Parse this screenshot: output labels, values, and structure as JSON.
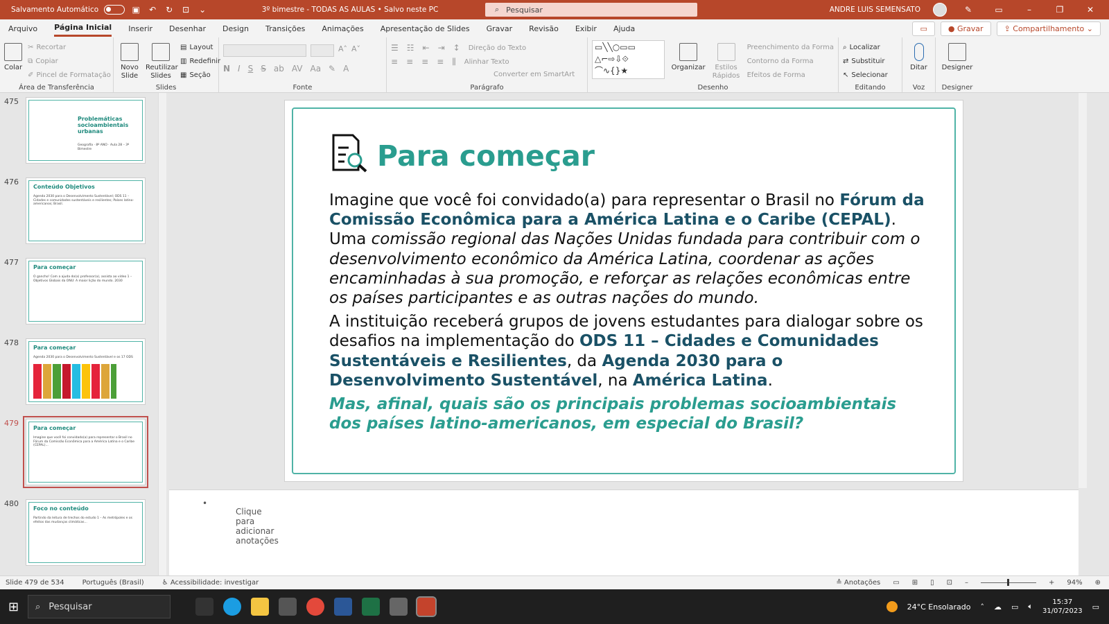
{
  "titlebar": {
    "autosave_label": "Salvamento Automático",
    "document_title": "3º bimestre - TODAS AS AULAS • Salvo neste PC",
    "search_placeholder": "Pesquisar",
    "user_name": "ANDRE LUIS SEMENSATO"
  },
  "menu": {
    "items": [
      "Arquivo",
      "Página Inicial",
      "Inserir",
      "Desenhar",
      "Design",
      "Transições",
      "Animações",
      "Apresentação de Slides",
      "Gravar",
      "Revisão",
      "Exibir",
      "Ajuda"
    ],
    "active": "Página Inicial",
    "record_button": "Gravar",
    "share_button": "Compartilhamento"
  },
  "ribbon": {
    "clipboard": {
      "label": "Área de Transferência",
      "paste": "Colar",
      "cut": "Recortar",
      "copy": "Copiar",
      "format_painter": "Pincel de Formatação"
    },
    "slides": {
      "label": "Slides",
      "new_slide": "Novo Slide",
      "reuse": "Reutilizar Slides",
      "layout": "Layout",
      "reset": "Redefinir",
      "section": "Seção"
    },
    "font": {
      "label": "Fonte"
    },
    "paragraph": {
      "label": "Parágrafo",
      "text_direction": "Direção do Texto",
      "align_text": "Alinhar Texto",
      "smartart": "Converter em SmartArt"
    },
    "drawing": {
      "label": "Desenho",
      "arrange": "Organizar",
      "quick_styles": "Estilos Rápidos",
      "shape_fill": "Preenchimento da Forma",
      "shape_outline": "Contorno da Forma",
      "shape_effects": "Efeitos de Forma"
    },
    "editing": {
      "label": "Editando",
      "find": "Localizar",
      "replace": "Substituir",
      "select": "Selecionar"
    },
    "voice": {
      "label": "Voz",
      "dictate": "Ditar"
    },
    "designer": {
      "label": "Designer",
      "designer": "Designer"
    }
  },
  "thumbnails": [
    {
      "num": "475",
      "title": "Problemáticas socioambientais urbanas",
      "text": "Geografia · 8º ANO · Aula 28 – 3º Bimestre"
    },
    {
      "num": "476",
      "title": "Conteúdo   Objetivos",
      "text": "Agenda 2030 para o Desenvolvimento Sustentável; ODS 11 – Cidades e comunidades sustentáveis e resilientes; Países latino-americanos; Brasil."
    },
    {
      "num": "477",
      "title": "Para começar",
      "text": "O gancho! Com a ajuda do(a) professor(a), assista ao vídeo 1 – Objetivos Globais da ONU: A maior lição do mundo. 2030"
    },
    {
      "num": "478",
      "title": "Para começar",
      "text": "Agenda 2030 para o Desenvolvimento Sustentável e os 17 ODS"
    },
    {
      "num": "479",
      "title": "Para começar",
      "text": "Imagine que você foi convidado(a) para representar o Brasil no Fórum da Comissão Econômica para a América Latina e o Caribe (CEPAL)..."
    },
    {
      "num": "480",
      "title": "Foco no conteúdo",
      "text": "Partindo da leitura de trechos do estudo 1 – As metrópoles e os efeitos das mudanças climáticas..."
    }
  ],
  "slide": {
    "title": "Para começar",
    "p1_a": "Imagine que você foi convidado(a) para representar o Brasil no ",
    "p1_b": "Fórum da Comissão Econômica para a América Latina e o Caribe (CEPAL)",
    "p1_c": ". Uma ",
    "p1_d": "comissão regional das Nações Unidas fundada para contribuir com o desenvolvimento econômico da América Latina, coordenar as ações encaminhadas à sua promoção, e reforçar as relações econômicas entre os países participantes e as outras nações do mundo.",
    "p2_a": "A instituição receberá grupos de jovens estudantes para dialogar sobre os desafios na implementação do ",
    "p2_b": "ODS 11 – Cidades e Comunidades Sustentáveis e Resilientes",
    "p2_c": ", da ",
    "p2_d": "Agenda 2030 para o Desenvolvimento Sustentável",
    "p2_e": ", na ",
    "p2_f": "América Latina",
    "p2_g": ".",
    "question": "Mas, afinal, quais são os principais problemas socioambientais dos países latino-americanos, em especial do Brasil?"
  },
  "notes": {
    "placeholder": "Clique para adicionar anotações"
  },
  "status": {
    "slide_count": "Slide 479 de 534",
    "language": "Português (Brasil)",
    "accessibility": "Acessibilidade: investigar",
    "notes_button": "Anotações",
    "zoom": "94%"
  },
  "taskbar": {
    "search": "Pesquisar",
    "weather": "24°C  Ensolarado",
    "time": "15:37",
    "date": "31/07/2023"
  },
  "colors": {
    "accent": "#b7472a",
    "teal": "#2a9d8f",
    "dark_teal": "#1a5166"
  }
}
